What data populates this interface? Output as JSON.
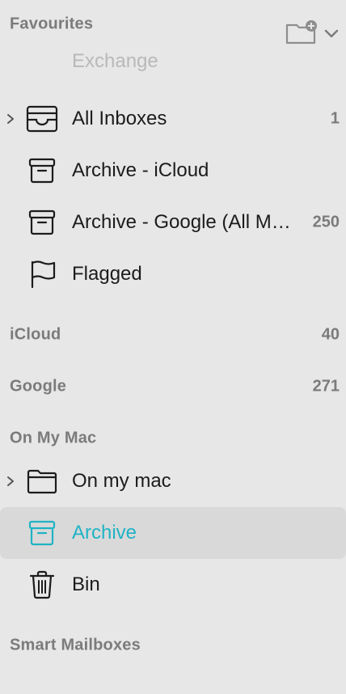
{
  "sections": {
    "favourites": {
      "title": "Favourites"
    },
    "icloud": {
      "title": "iCloud",
      "count": "40"
    },
    "google": {
      "title": "Google",
      "count": "271"
    },
    "on_my_mac": {
      "title": "On My Mac"
    },
    "smart_mailboxes": {
      "title": "Smart Mailboxes"
    }
  },
  "favourites": {
    "subheader": "Exchange",
    "items": [
      {
        "label": "All Inboxes",
        "count": "1",
        "icon": "inbox-tray-icon",
        "disclosure": true
      },
      {
        "label": "Archive - iCloud",
        "count": "",
        "icon": "archive-box-icon"
      },
      {
        "label": "Archive - Google (All Mail)",
        "count": "250",
        "icon": "archive-box-icon"
      },
      {
        "label": "Flagged",
        "count": "",
        "icon": "flag-icon"
      }
    ]
  },
  "on_my_mac": {
    "items": [
      {
        "label": "On my mac",
        "icon": "folder-icon",
        "disclosure": true
      },
      {
        "label": "Archive",
        "icon": "archive-box-icon",
        "selected": true
      },
      {
        "label": "Bin",
        "icon": "trash-icon"
      }
    ]
  },
  "colors": {
    "sidebar_bg": "#e7e7e7",
    "selected_bg": "#d9d9d9",
    "accent": "#1fb3c5",
    "section_header": "#7b7b7b",
    "muted": "#b9b9b9",
    "text": "#1c1c1e"
  }
}
